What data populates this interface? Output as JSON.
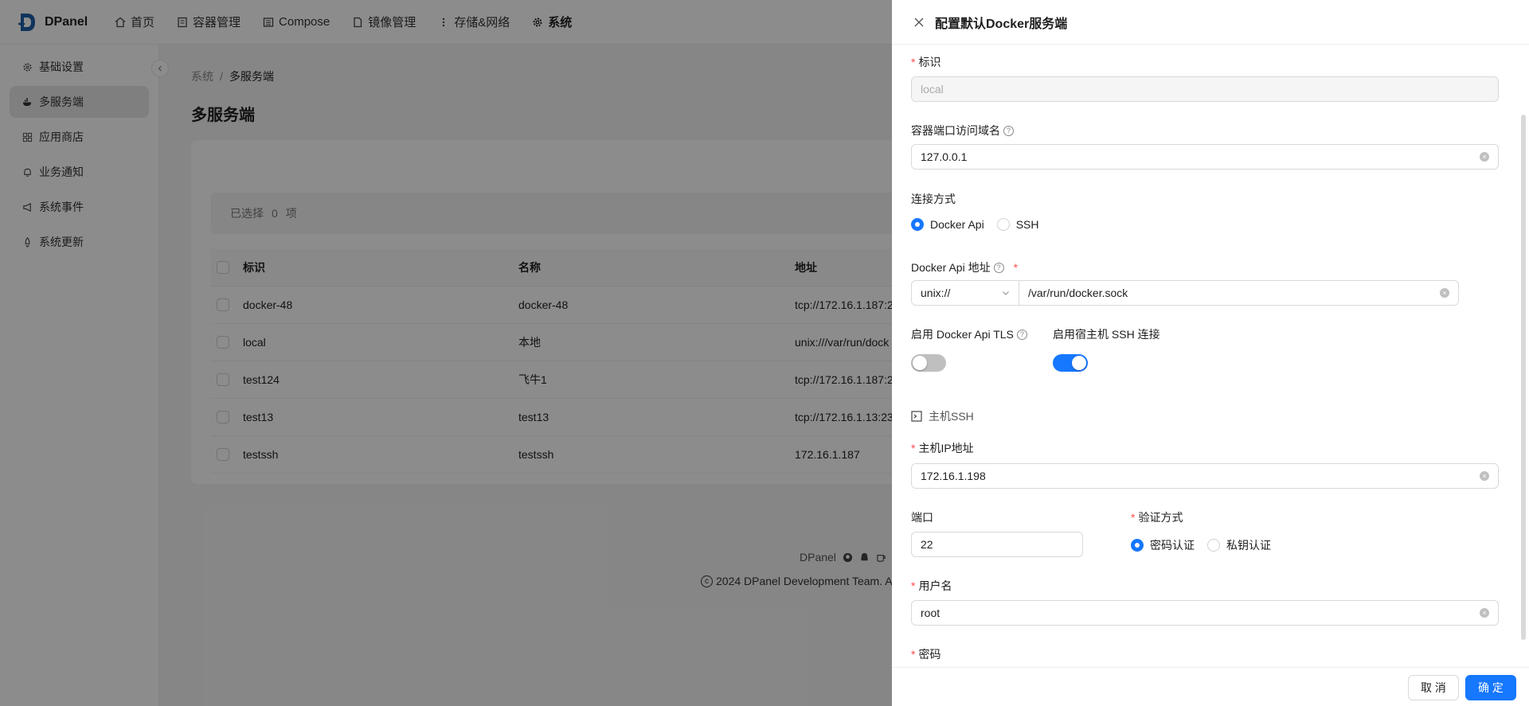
{
  "brand": {
    "name": "DPanel"
  },
  "topnav": [
    {
      "label": "首页",
      "icon": "home-icon"
    },
    {
      "label": "容器管理",
      "icon": "container-icon"
    },
    {
      "label": "Compose",
      "icon": "compose-icon"
    },
    {
      "label": "镜像管理",
      "icon": "image-icon"
    },
    {
      "label": "存储&网络",
      "icon": "storage-icon"
    },
    {
      "label": "系统",
      "icon": "gear-icon",
      "active": true
    }
  ],
  "sidebar": [
    {
      "label": "基础设置",
      "icon": "settings-icon"
    },
    {
      "label": "多服务端",
      "icon": "docker-icon",
      "active": true
    },
    {
      "label": "应用商店",
      "icon": "apps-icon"
    },
    {
      "label": "业务通知",
      "icon": "bell-icon"
    },
    {
      "label": "系统事件",
      "icon": "megaphone-icon"
    },
    {
      "label": "系统更新",
      "icon": "rocket-icon"
    }
  ],
  "breadcrumb": {
    "parent": "系统",
    "separator": "/",
    "current": "多服务端"
  },
  "page_title": "多服务端",
  "selection": {
    "prefix": "已选择",
    "count": "0",
    "suffix": "项"
  },
  "table": {
    "headers": [
      "标识",
      "名称",
      "地址"
    ],
    "rows": [
      {
        "id": "docker-48",
        "name": "docker-48",
        "address": "tcp://172.16.1.187:2"
      },
      {
        "id": "local",
        "name": "本地",
        "address": "unix:///var/run/dock"
      },
      {
        "id": "test124",
        "name": "飞牛1",
        "address": "tcp://172.16.1.187:2"
      },
      {
        "id": "test13",
        "name": "test13",
        "address": "tcp://172.16.1.13:23"
      },
      {
        "id": "testssh",
        "name": "testssh",
        "address": "172.16.1.187"
      }
    ]
  },
  "footer": {
    "name": "DPanel",
    "copyright": "2024 DPanel Development Team. A"
  },
  "drawer": {
    "title": "配置默认Docker服务端",
    "fields": {
      "identifier": {
        "label": "标识",
        "placeholder": "local"
      },
      "domain": {
        "label": "容器端口访问域名",
        "value": "127.0.0.1"
      },
      "connection": {
        "label": "连接方式",
        "options": [
          "Docker Api",
          "SSH"
        ],
        "selected": "Docker Api"
      },
      "api_address": {
        "label": "Docker Api 地址",
        "scheme": "unix://",
        "path": "/var/run/docker.sock"
      },
      "tls": {
        "label": "启用 Docker Api TLS",
        "enabled": false
      },
      "host_ssh": {
        "label": "启用宿主机 SSH 连接",
        "enabled": true
      },
      "ssh_section": {
        "title": "主机SSH"
      },
      "host_ip": {
        "label": "主机IP地址",
        "value": "172.16.1.198"
      },
      "port": {
        "label": "端口",
        "value": "22"
      },
      "auth": {
        "label": "验证方式",
        "options": [
          "密码认证",
          "私钥认证"
        ],
        "selected": "密码认证"
      },
      "username": {
        "label": "用户名",
        "value": "root"
      },
      "password": {
        "label": "密码"
      }
    },
    "buttons": {
      "cancel": "取 消",
      "confirm": "确 定"
    }
  },
  "colors": {
    "primary": "#1677ff",
    "required": "#ff4d4f",
    "mask": "rgba(0,0,0,0.45)"
  }
}
